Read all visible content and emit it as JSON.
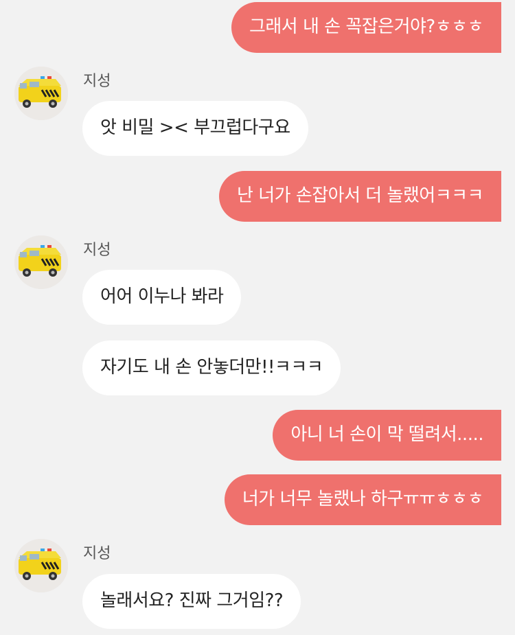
{
  "messages": [
    {
      "direction": "outgoing",
      "text": "그래서 내 손 꼭잡은거야?ㅎㅎㅎ"
    },
    {
      "direction": "incoming",
      "sender": "지성",
      "text": "앗 비밀 >< 부끄럽다구요"
    },
    {
      "direction": "outgoing",
      "text": "난 너가 손잡아서 더 놀랬어ㅋㅋㅋ"
    },
    {
      "direction": "incoming",
      "sender": "지성",
      "text": "어어 이누나 봐라"
    },
    {
      "direction": "incoming",
      "text": "자기도 내 손 안놓더만!!ㅋㅋㅋ"
    },
    {
      "direction": "outgoing",
      "text": "아니 너 손이 막 떨려서....."
    },
    {
      "direction": "outgoing",
      "text": "너가 너무 놀랬나 하구ㅠㅠㅎㅎㅎ"
    },
    {
      "direction": "incoming",
      "sender": "지성",
      "text": "놀래서요? 진짜 그거임??"
    }
  ],
  "avatar": {
    "icon": "toy-ambulance-icon",
    "body_color": "#f2d21b",
    "stripe_color": "#222222",
    "light_color": "#3aa7e8"
  },
  "colors": {
    "background": "#f2f2f2",
    "outgoing_bubble": "#ef716d",
    "incoming_bubble": "#ffffff"
  }
}
